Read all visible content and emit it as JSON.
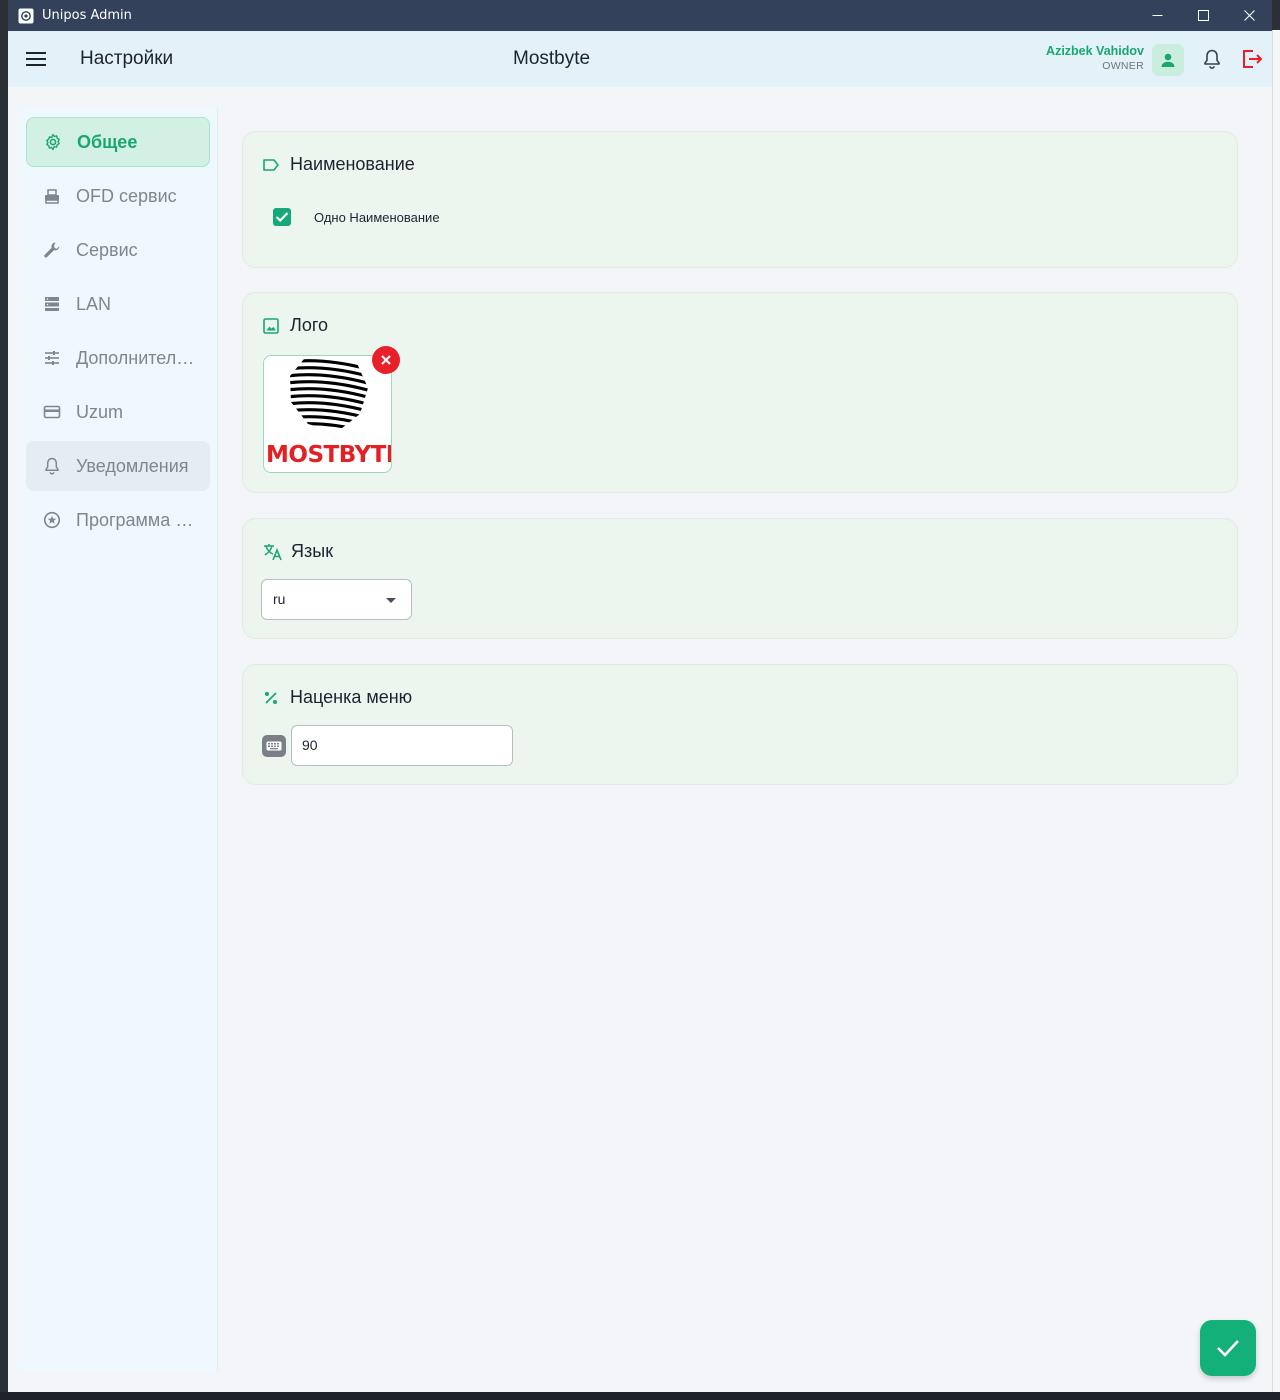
{
  "window": {
    "title": "Unipos Admin"
  },
  "header": {
    "page_title": "Настройки",
    "company": "Mostbyte",
    "user_name": "Azizbek Vahidov",
    "user_role": "OWNER"
  },
  "sidebar": {
    "items": [
      {
        "label": "Общее",
        "icon": "gear-icon",
        "active": true
      },
      {
        "label": "OFD сервис",
        "icon": "printer-icon"
      },
      {
        "label": "Сервис",
        "icon": "wrench-icon"
      },
      {
        "label": "LAN",
        "icon": "server-icon"
      },
      {
        "label": "Дополнительно",
        "icon": "sliders-icon"
      },
      {
        "label": "Uzum",
        "icon": "card-icon"
      },
      {
        "label": "Уведомления",
        "icon": "bell-icon"
      },
      {
        "label": "Программа лояльности",
        "icon": "star-icon"
      }
    ]
  },
  "sections": {
    "naming": {
      "title": "Наименование",
      "checkbox_label": "Одно Наименование",
      "checked": true
    },
    "logo": {
      "title": "Лого",
      "logo_text": "MOSTBYTE"
    },
    "language": {
      "title": "Язык",
      "selected": "ru"
    },
    "markup": {
      "title": "Наценка меню",
      "value": "90"
    }
  },
  "colors": {
    "accent": "#14b079",
    "accent_text": "#1aa76e",
    "danger": "#e8202a",
    "titlebar": "#33425a",
    "appbar": "#e3f1f9",
    "card": "#edf6ee"
  }
}
